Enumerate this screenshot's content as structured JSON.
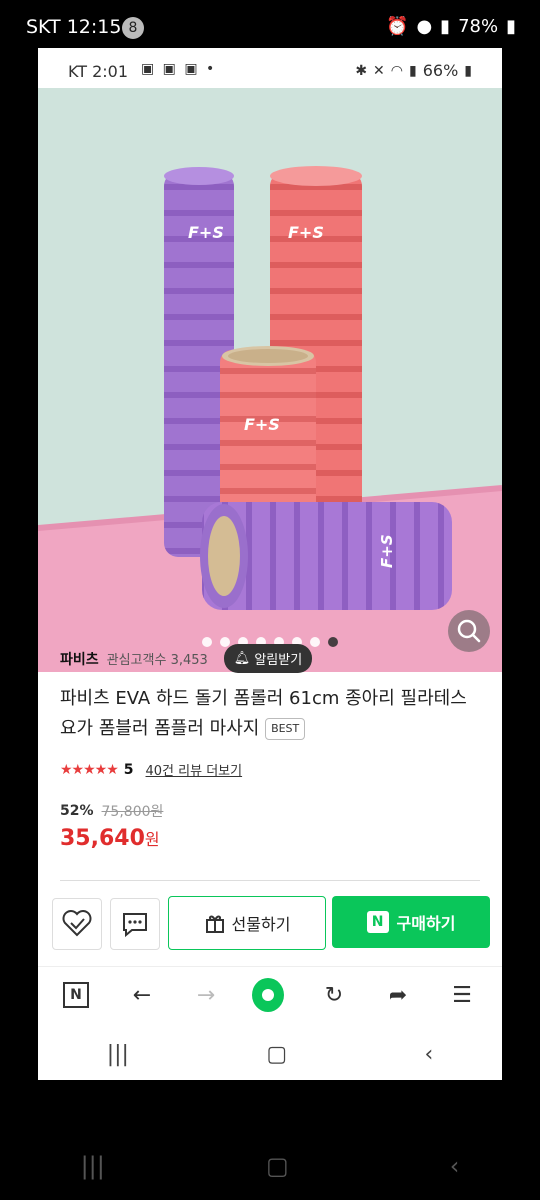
{
  "outer_status": {
    "time": "SKT 12:15",
    "badge": "8",
    "battery": "78%"
  },
  "inner_status": {
    "time": "KT 2:01",
    "battery": "66%"
  },
  "image": {
    "dots_count": 8,
    "active_dot": 7,
    "brand_mark": "F+S"
  },
  "store": {
    "name": "파비츠",
    "meta": "관심고객수 3,453",
    "alert_label": "알림받기"
  },
  "product": {
    "title": "파비츠 EVA 하드 돌기 폼롤러 61cm 종아리 필라테스 요가 폼블러 폼플러 마사지",
    "badge": "BEST",
    "stars": "★★★★★",
    "rating": "5",
    "review_link": "40건 리뷰 더보기",
    "discount": "52%",
    "original_price": "75,800원",
    "price": "35,640",
    "price_unit": "원"
  },
  "actions": {
    "gift_label": "선물하기",
    "buy_label": "구매하기",
    "buy_badge": "N"
  },
  "browser": {
    "logo": "N"
  },
  "colors": {
    "accent_green": "#0ac65a",
    "price_red": "#e02d2d"
  }
}
